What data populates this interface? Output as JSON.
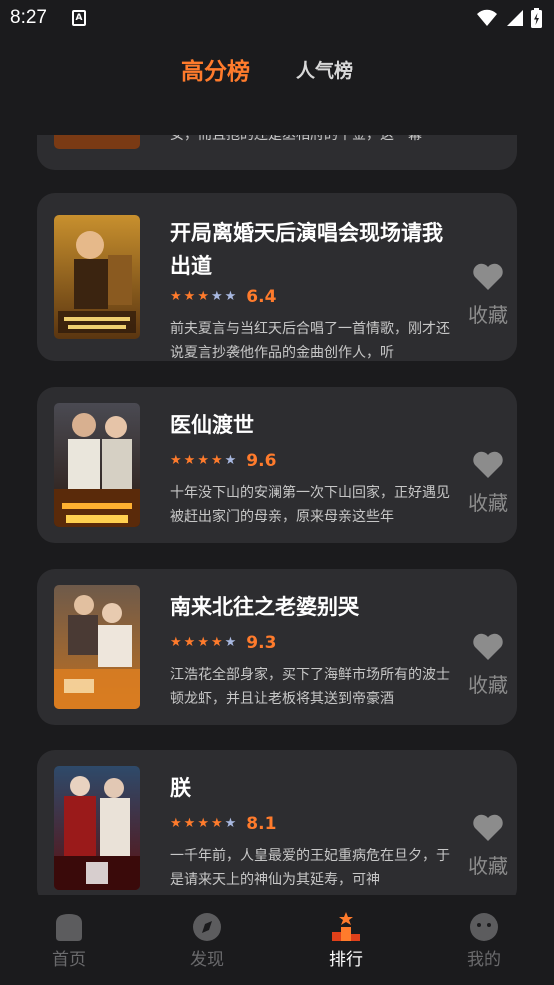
{
  "status": {
    "time": "8:27",
    "notification_icon": "A"
  },
  "tabs": {
    "high_score": "高分榜",
    "popular": "人气榜"
  },
  "partial_card": {
    "desc": "女，而且抱的还是丞相府的千金，这一幕"
  },
  "cards": [
    {
      "title": "开局离婚天后演唱会现场请我出道",
      "rating": 3,
      "score": "6.4",
      "desc": "前夫夏言与当红天后合唱了一首情歌，刚才还说夏言抄袭他作品的金曲创作人，听",
      "fav": "收藏"
    },
    {
      "title": "医仙渡世",
      "rating": 4,
      "score": "9.6",
      "desc": "十年没下山的安澜第一次下山回家，正好遇见被赶出家门的母亲，原来母亲这些年",
      "fav": "收藏"
    },
    {
      "title": "南来北往之老婆别哭",
      "rating": 4,
      "score": "9.3",
      "desc": "江浩花全部身家，买下了海鲜市场所有的波士顿龙虾，并且让老板将其送到帝豪酒",
      "fav": "收藏"
    },
    {
      "title": "朕",
      "rating": 4,
      "score": "8.1",
      "desc": "一千年前，人皇最爱的王妃重病危在旦夕，于是请来天上的神仙为其延寿，可神",
      "fav": "收藏"
    }
  ],
  "nav": {
    "home": "首页",
    "discover": "发现",
    "ranking": "排行",
    "mine": "我的"
  },
  "colors": {
    "accent": "#ff7b2c",
    "card_bg": "#2d2d30",
    "page_bg": "#1b1b1d"
  }
}
